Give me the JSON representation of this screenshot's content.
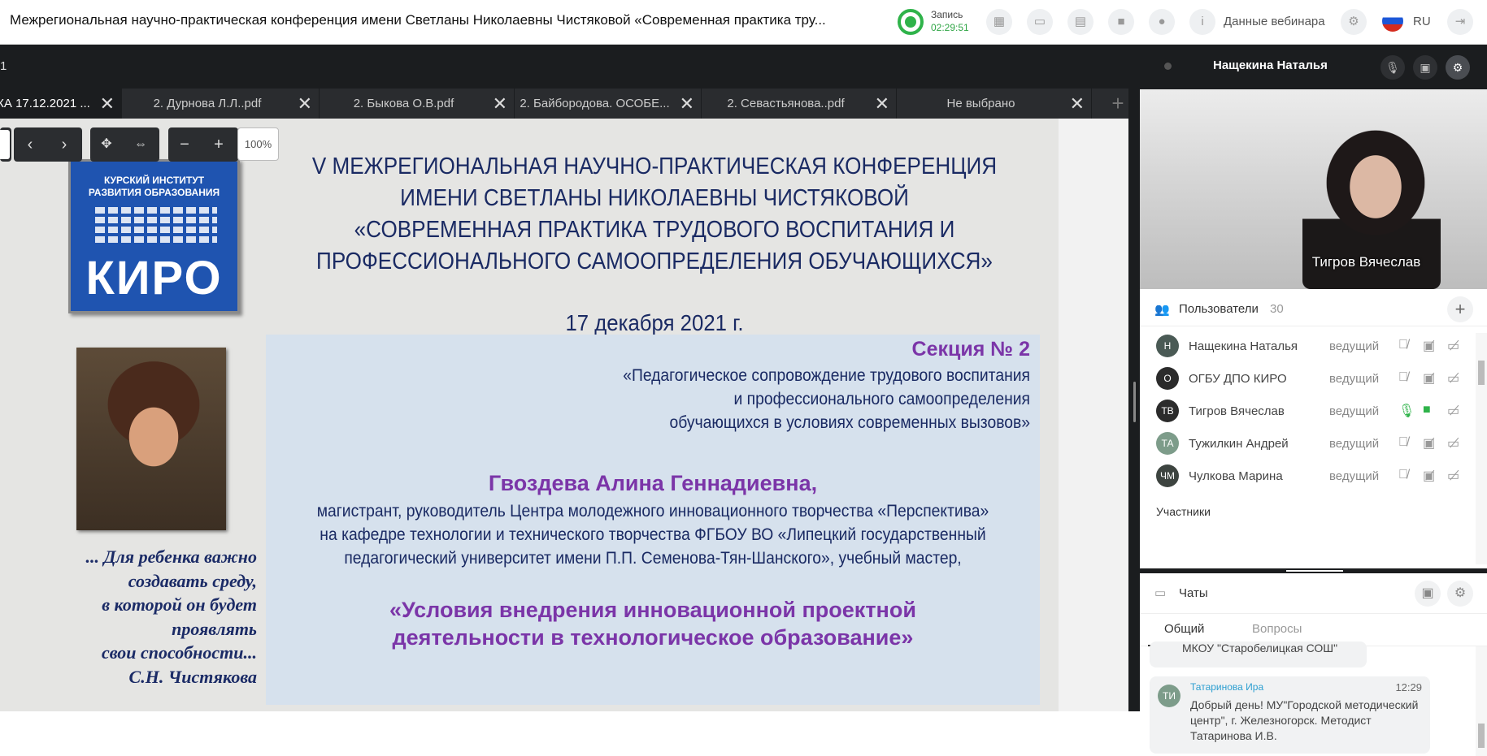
{
  "header": {
    "title": "Межрегиональная научно-практическая конференция имени Светланы Николаевны Чистяковой «Современная практика тру...",
    "record_label": "Запись",
    "record_time": "02:29:51",
    "webinar_data_label": "Данные вебинара",
    "language": "RU",
    "accent_color": "#2fb34a"
  },
  "presentation": {
    "page": "1",
    "zoom": "100%",
    "tabs": [
      {
        "label": "КА 17.12.2021 ...",
        "active": true
      },
      {
        "label": "2. Дурнова Л.Л..pdf"
      },
      {
        "label": "2. Быкова О.В.pdf"
      },
      {
        "label": "2. Байбородова. ОСОБЕ..."
      },
      {
        "label": "2. Севастьянова..pdf"
      },
      {
        "label": "Не выбрано"
      }
    ]
  },
  "slide": {
    "logo_top": "КУРСКИЙ ИНСТИТУТ\nРАЗВИТИЯ ОБРАЗОВАНИЯ",
    "logo_main": "КИРО",
    "quote": "... Для ребенка важно\nсоздавать среду,\nв которой он будет\nпроявлять\nсвои способности...\nС.Н. Чистякова",
    "conf_title": "V МЕЖРЕГИОНАЛЬНАЯ НАУЧНО-ПРАКТИЧЕСКАЯ КОНФЕРЕНЦИЯ\nИМЕНИ СВЕТЛАНЫ НИКОЛАЕВНЫ ЧИСТЯКОВОЙ\n«СОВРЕМЕННАЯ ПРАКТИКА ТРУДОВОГО ВОСПИТАНИЯ И\nПРОФЕССИОНАЛЬНОГО САМООПРЕДЕЛЕНИЯ ОБУЧАЮЩИХСЯ»",
    "date": "17 декабря 2021 г.",
    "section": "Секция № 2",
    "section_title": "«Педагогическое сопровождение трудового воспитания\nи профессионального самоопределения\nобучающихся в условиях современных вызовов»",
    "author": "Гвоздева Алина Геннадиевна,",
    "author_desc": "магистрант, руководитель Центра молодежного инновационного творчества «Перспектива»\nна кафедре технологии и технического творчества ФГБОУ ВО «Липецкий государственный\nпедагогический университет имени П.П. Семенова-Тян-Шанского», учебный мастер,",
    "report": "«Условия внедрения инновационной проектной\nдеятельности в технологическое образование»"
  },
  "video": {
    "presenter": "Нащекина Наталья",
    "caption": "Тигров Вячеслав"
  },
  "users": {
    "label": "Пользователи",
    "count": "30",
    "participants_label": "Участники",
    "list": [
      {
        "initials": "Н",
        "name": "Нащекина Наталья",
        "role": "ведущий",
        "color": "#4a5a55",
        "mic": "off",
        "cam": "off"
      },
      {
        "initials": "О",
        "name": "ОГБУ ДПО КИРО",
        "role": "ведущий",
        "color": "#2b2b2b",
        "mic": "off",
        "cam": "off"
      },
      {
        "initials": "ТВ",
        "name": "Тигров Вячеслав",
        "role": "ведущий",
        "color": "#2b2b2b",
        "mic": "on",
        "cam": "on"
      },
      {
        "initials": "ТА",
        "name": "Тужилкин Андрей",
        "role": "ведущий",
        "color": "#7d9c8a",
        "mic": "off",
        "cam": "off"
      },
      {
        "initials": "ЧМ",
        "name": "Чулкова Марина",
        "role": "ведущий",
        "color": "#3d4440",
        "mic": "off",
        "cam": "off"
      }
    ]
  },
  "chats": {
    "label": "Чаты",
    "tab_general": "Общий",
    "tab_questions": "Вопросы",
    "prev_message_tail": "МКОУ \"Старобелицкая СОШ\"",
    "message": {
      "initials": "ТИ",
      "author": "Татаринова Ира",
      "time": "12:29",
      "text": "Добрый день! МУ\"Городской методический центр\", г. Железногорск. Методист Татаринова И.В."
    }
  }
}
